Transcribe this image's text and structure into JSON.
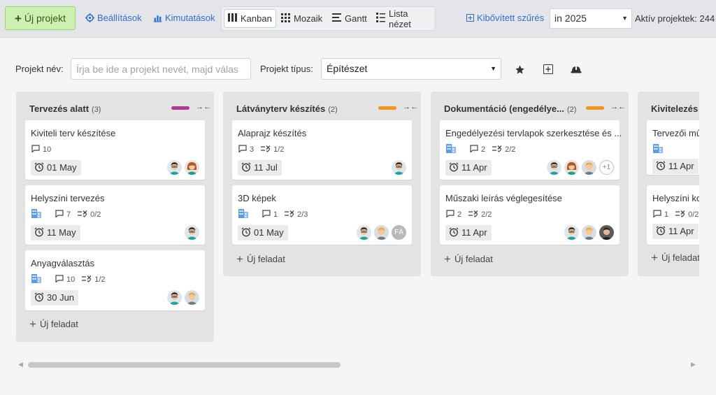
{
  "toolbar": {
    "new_project": "Új projekt",
    "settings": "Beállítások",
    "reports": "Kimutatások",
    "views": [
      "Kanban",
      "Mozaik",
      "Gantt",
      "Lista nézet"
    ],
    "active_view": "Kanban",
    "advanced_filter": "Kibővített szűrés",
    "year_filter": "in 2025",
    "active_projects": "Aktív projektek: 244"
  },
  "filters": {
    "project_name_label": "Projekt név:",
    "project_name_placeholder": "Írja be ide a projekt nevét, majd válas",
    "project_type_label": "Projekt típus:",
    "project_type_value": "Építészet"
  },
  "colors": {
    "accent_link": "#2f6fd4",
    "new_button": "#cdf0b2",
    "purple": "#b03a8f",
    "orange": "#f0951e"
  },
  "columns": [
    {
      "title": "Tervezés alatt",
      "count": "(3)",
      "color": "#b03a8f",
      "add_label": "Új feladat",
      "cards": [
        {
          "title": "Kiviteli terv készítése",
          "comments": "10",
          "subtasks": "",
          "building": false,
          "date": "01 May",
          "avatars": [
            "m",
            "f"
          ]
        },
        {
          "title": "Helyszíni tervezés",
          "comments": "7",
          "subtasks": "0/2",
          "building": true,
          "date": "11 May",
          "avatars": [
            "m"
          ]
        },
        {
          "title": "Anyagválasztás",
          "comments": "10",
          "subtasks": "1/2",
          "building": true,
          "date": "30 Jun",
          "avatars": [
            "m",
            "b"
          ]
        }
      ]
    },
    {
      "title": "Látványterv készítés",
      "count": "(2)",
      "color": "#f0951e",
      "add_label": "Új feladat",
      "cards": [
        {
          "title": "Alaprajz készítés",
          "comments": "3",
          "subtasks": "1/2",
          "building": false,
          "date": "11 Jul",
          "avatars": [
            "m"
          ]
        },
        {
          "title": "3D képek",
          "comments": "1",
          "subtasks": "2/3",
          "building": true,
          "date": "01 May",
          "avatars": [
            "m",
            "b",
            "FÁ"
          ]
        }
      ]
    },
    {
      "title": "Dokumentáció (engedélye...",
      "count": "(2)",
      "color": "#f0951e",
      "add_label": "Új feladat",
      "cards": [
        {
          "title": "Engedélyezési tervlapok szerkesztése és ...",
          "comments": "2",
          "subtasks": "2/2",
          "building": true,
          "date": "11 Apr",
          "avatars": [
            "m",
            "f",
            "b",
            "+1"
          ]
        },
        {
          "title": "Műszaki leírás véglegesítése",
          "comments": "2",
          "subtasks": "2/2",
          "building": false,
          "date": "11 Apr",
          "avatars": [
            "m",
            "b",
            "p"
          ]
        }
      ]
    },
    {
      "title": "Kivitelezés",
      "count": "",
      "color": "#f0951e",
      "add_label": "Új feladat",
      "cards": [
        {
          "title": "Tervezői mű",
          "comments": "",
          "subtasks": "",
          "building": true,
          "date": "11 Apr",
          "avatars": []
        },
        {
          "title": "Helyszíni ko",
          "comments": "1",
          "subtasks": "0/2",
          "building": false,
          "date": "11 Apr",
          "avatars": []
        }
      ]
    }
  ]
}
